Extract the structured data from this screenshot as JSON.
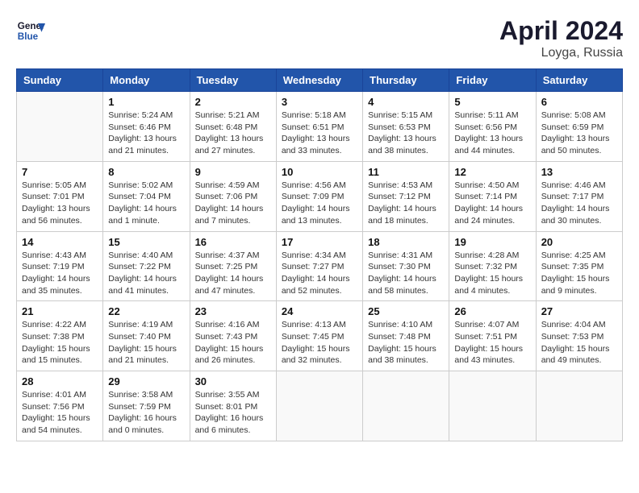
{
  "logo": {
    "line1": "General",
    "line2": "Blue"
  },
  "title": "April 2024",
  "location": "Loyga, Russia",
  "weekdays": [
    "Sunday",
    "Monday",
    "Tuesday",
    "Wednesday",
    "Thursday",
    "Friday",
    "Saturday"
  ],
  "weeks": [
    [
      {
        "day": "",
        "sunrise": "",
        "sunset": "",
        "daylight": ""
      },
      {
        "day": "1",
        "sunrise": "Sunrise: 5:24 AM",
        "sunset": "Sunset: 6:46 PM",
        "daylight": "Daylight: 13 hours and 21 minutes."
      },
      {
        "day": "2",
        "sunrise": "Sunrise: 5:21 AM",
        "sunset": "Sunset: 6:48 PM",
        "daylight": "Daylight: 13 hours and 27 minutes."
      },
      {
        "day": "3",
        "sunrise": "Sunrise: 5:18 AM",
        "sunset": "Sunset: 6:51 PM",
        "daylight": "Daylight: 13 hours and 33 minutes."
      },
      {
        "day": "4",
        "sunrise": "Sunrise: 5:15 AM",
        "sunset": "Sunset: 6:53 PM",
        "daylight": "Daylight: 13 hours and 38 minutes."
      },
      {
        "day": "5",
        "sunrise": "Sunrise: 5:11 AM",
        "sunset": "Sunset: 6:56 PM",
        "daylight": "Daylight: 13 hours and 44 minutes."
      },
      {
        "day": "6",
        "sunrise": "Sunrise: 5:08 AM",
        "sunset": "Sunset: 6:59 PM",
        "daylight": "Daylight: 13 hours and 50 minutes."
      }
    ],
    [
      {
        "day": "7",
        "sunrise": "Sunrise: 5:05 AM",
        "sunset": "Sunset: 7:01 PM",
        "daylight": "Daylight: 13 hours and 56 minutes."
      },
      {
        "day": "8",
        "sunrise": "Sunrise: 5:02 AM",
        "sunset": "Sunset: 7:04 PM",
        "daylight": "Daylight: 14 hours and 1 minute."
      },
      {
        "day": "9",
        "sunrise": "Sunrise: 4:59 AM",
        "sunset": "Sunset: 7:06 PM",
        "daylight": "Daylight: 14 hours and 7 minutes."
      },
      {
        "day": "10",
        "sunrise": "Sunrise: 4:56 AM",
        "sunset": "Sunset: 7:09 PM",
        "daylight": "Daylight: 14 hours and 13 minutes."
      },
      {
        "day": "11",
        "sunrise": "Sunrise: 4:53 AM",
        "sunset": "Sunset: 7:12 PM",
        "daylight": "Daylight: 14 hours and 18 minutes."
      },
      {
        "day": "12",
        "sunrise": "Sunrise: 4:50 AM",
        "sunset": "Sunset: 7:14 PM",
        "daylight": "Daylight: 14 hours and 24 minutes."
      },
      {
        "day": "13",
        "sunrise": "Sunrise: 4:46 AM",
        "sunset": "Sunset: 7:17 PM",
        "daylight": "Daylight: 14 hours and 30 minutes."
      }
    ],
    [
      {
        "day": "14",
        "sunrise": "Sunrise: 4:43 AM",
        "sunset": "Sunset: 7:19 PM",
        "daylight": "Daylight: 14 hours and 35 minutes."
      },
      {
        "day": "15",
        "sunrise": "Sunrise: 4:40 AM",
        "sunset": "Sunset: 7:22 PM",
        "daylight": "Daylight: 14 hours and 41 minutes."
      },
      {
        "day": "16",
        "sunrise": "Sunrise: 4:37 AM",
        "sunset": "Sunset: 7:25 PM",
        "daylight": "Daylight: 14 hours and 47 minutes."
      },
      {
        "day": "17",
        "sunrise": "Sunrise: 4:34 AM",
        "sunset": "Sunset: 7:27 PM",
        "daylight": "Daylight: 14 hours and 52 minutes."
      },
      {
        "day": "18",
        "sunrise": "Sunrise: 4:31 AM",
        "sunset": "Sunset: 7:30 PM",
        "daylight": "Daylight: 14 hours and 58 minutes."
      },
      {
        "day": "19",
        "sunrise": "Sunrise: 4:28 AM",
        "sunset": "Sunset: 7:32 PM",
        "daylight": "Daylight: 15 hours and 4 minutes."
      },
      {
        "day": "20",
        "sunrise": "Sunrise: 4:25 AM",
        "sunset": "Sunset: 7:35 PM",
        "daylight": "Daylight: 15 hours and 9 minutes."
      }
    ],
    [
      {
        "day": "21",
        "sunrise": "Sunrise: 4:22 AM",
        "sunset": "Sunset: 7:38 PM",
        "daylight": "Daylight: 15 hours and 15 minutes."
      },
      {
        "day": "22",
        "sunrise": "Sunrise: 4:19 AM",
        "sunset": "Sunset: 7:40 PM",
        "daylight": "Daylight: 15 hours and 21 minutes."
      },
      {
        "day": "23",
        "sunrise": "Sunrise: 4:16 AM",
        "sunset": "Sunset: 7:43 PM",
        "daylight": "Daylight: 15 hours and 26 minutes."
      },
      {
        "day": "24",
        "sunrise": "Sunrise: 4:13 AM",
        "sunset": "Sunset: 7:45 PM",
        "daylight": "Daylight: 15 hours and 32 minutes."
      },
      {
        "day": "25",
        "sunrise": "Sunrise: 4:10 AM",
        "sunset": "Sunset: 7:48 PM",
        "daylight": "Daylight: 15 hours and 38 minutes."
      },
      {
        "day": "26",
        "sunrise": "Sunrise: 4:07 AM",
        "sunset": "Sunset: 7:51 PM",
        "daylight": "Daylight: 15 hours and 43 minutes."
      },
      {
        "day": "27",
        "sunrise": "Sunrise: 4:04 AM",
        "sunset": "Sunset: 7:53 PM",
        "daylight": "Daylight: 15 hours and 49 minutes."
      }
    ],
    [
      {
        "day": "28",
        "sunrise": "Sunrise: 4:01 AM",
        "sunset": "Sunset: 7:56 PM",
        "daylight": "Daylight: 15 hours and 54 minutes."
      },
      {
        "day": "29",
        "sunrise": "Sunrise: 3:58 AM",
        "sunset": "Sunset: 7:59 PM",
        "daylight": "Daylight: 16 hours and 0 minutes."
      },
      {
        "day": "30",
        "sunrise": "Sunrise: 3:55 AM",
        "sunset": "Sunset: 8:01 PM",
        "daylight": "Daylight: 16 hours and 6 minutes."
      },
      {
        "day": "",
        "sunrise": "",
        "sunset": "",
        "daylight": ""
      },
      {
        "day": "",
        "sunrise": "",
        "sunset": "",
        "daylight": ""
      },
      {
        "day": "",
        "sunrise": "",
        "sunset": "",
        "daylight": ""
      },
      {
        "day": "",
        "sunrise": "",
        "sunset": "",
        "daylight": ""
      }
    ]
  ]
}
